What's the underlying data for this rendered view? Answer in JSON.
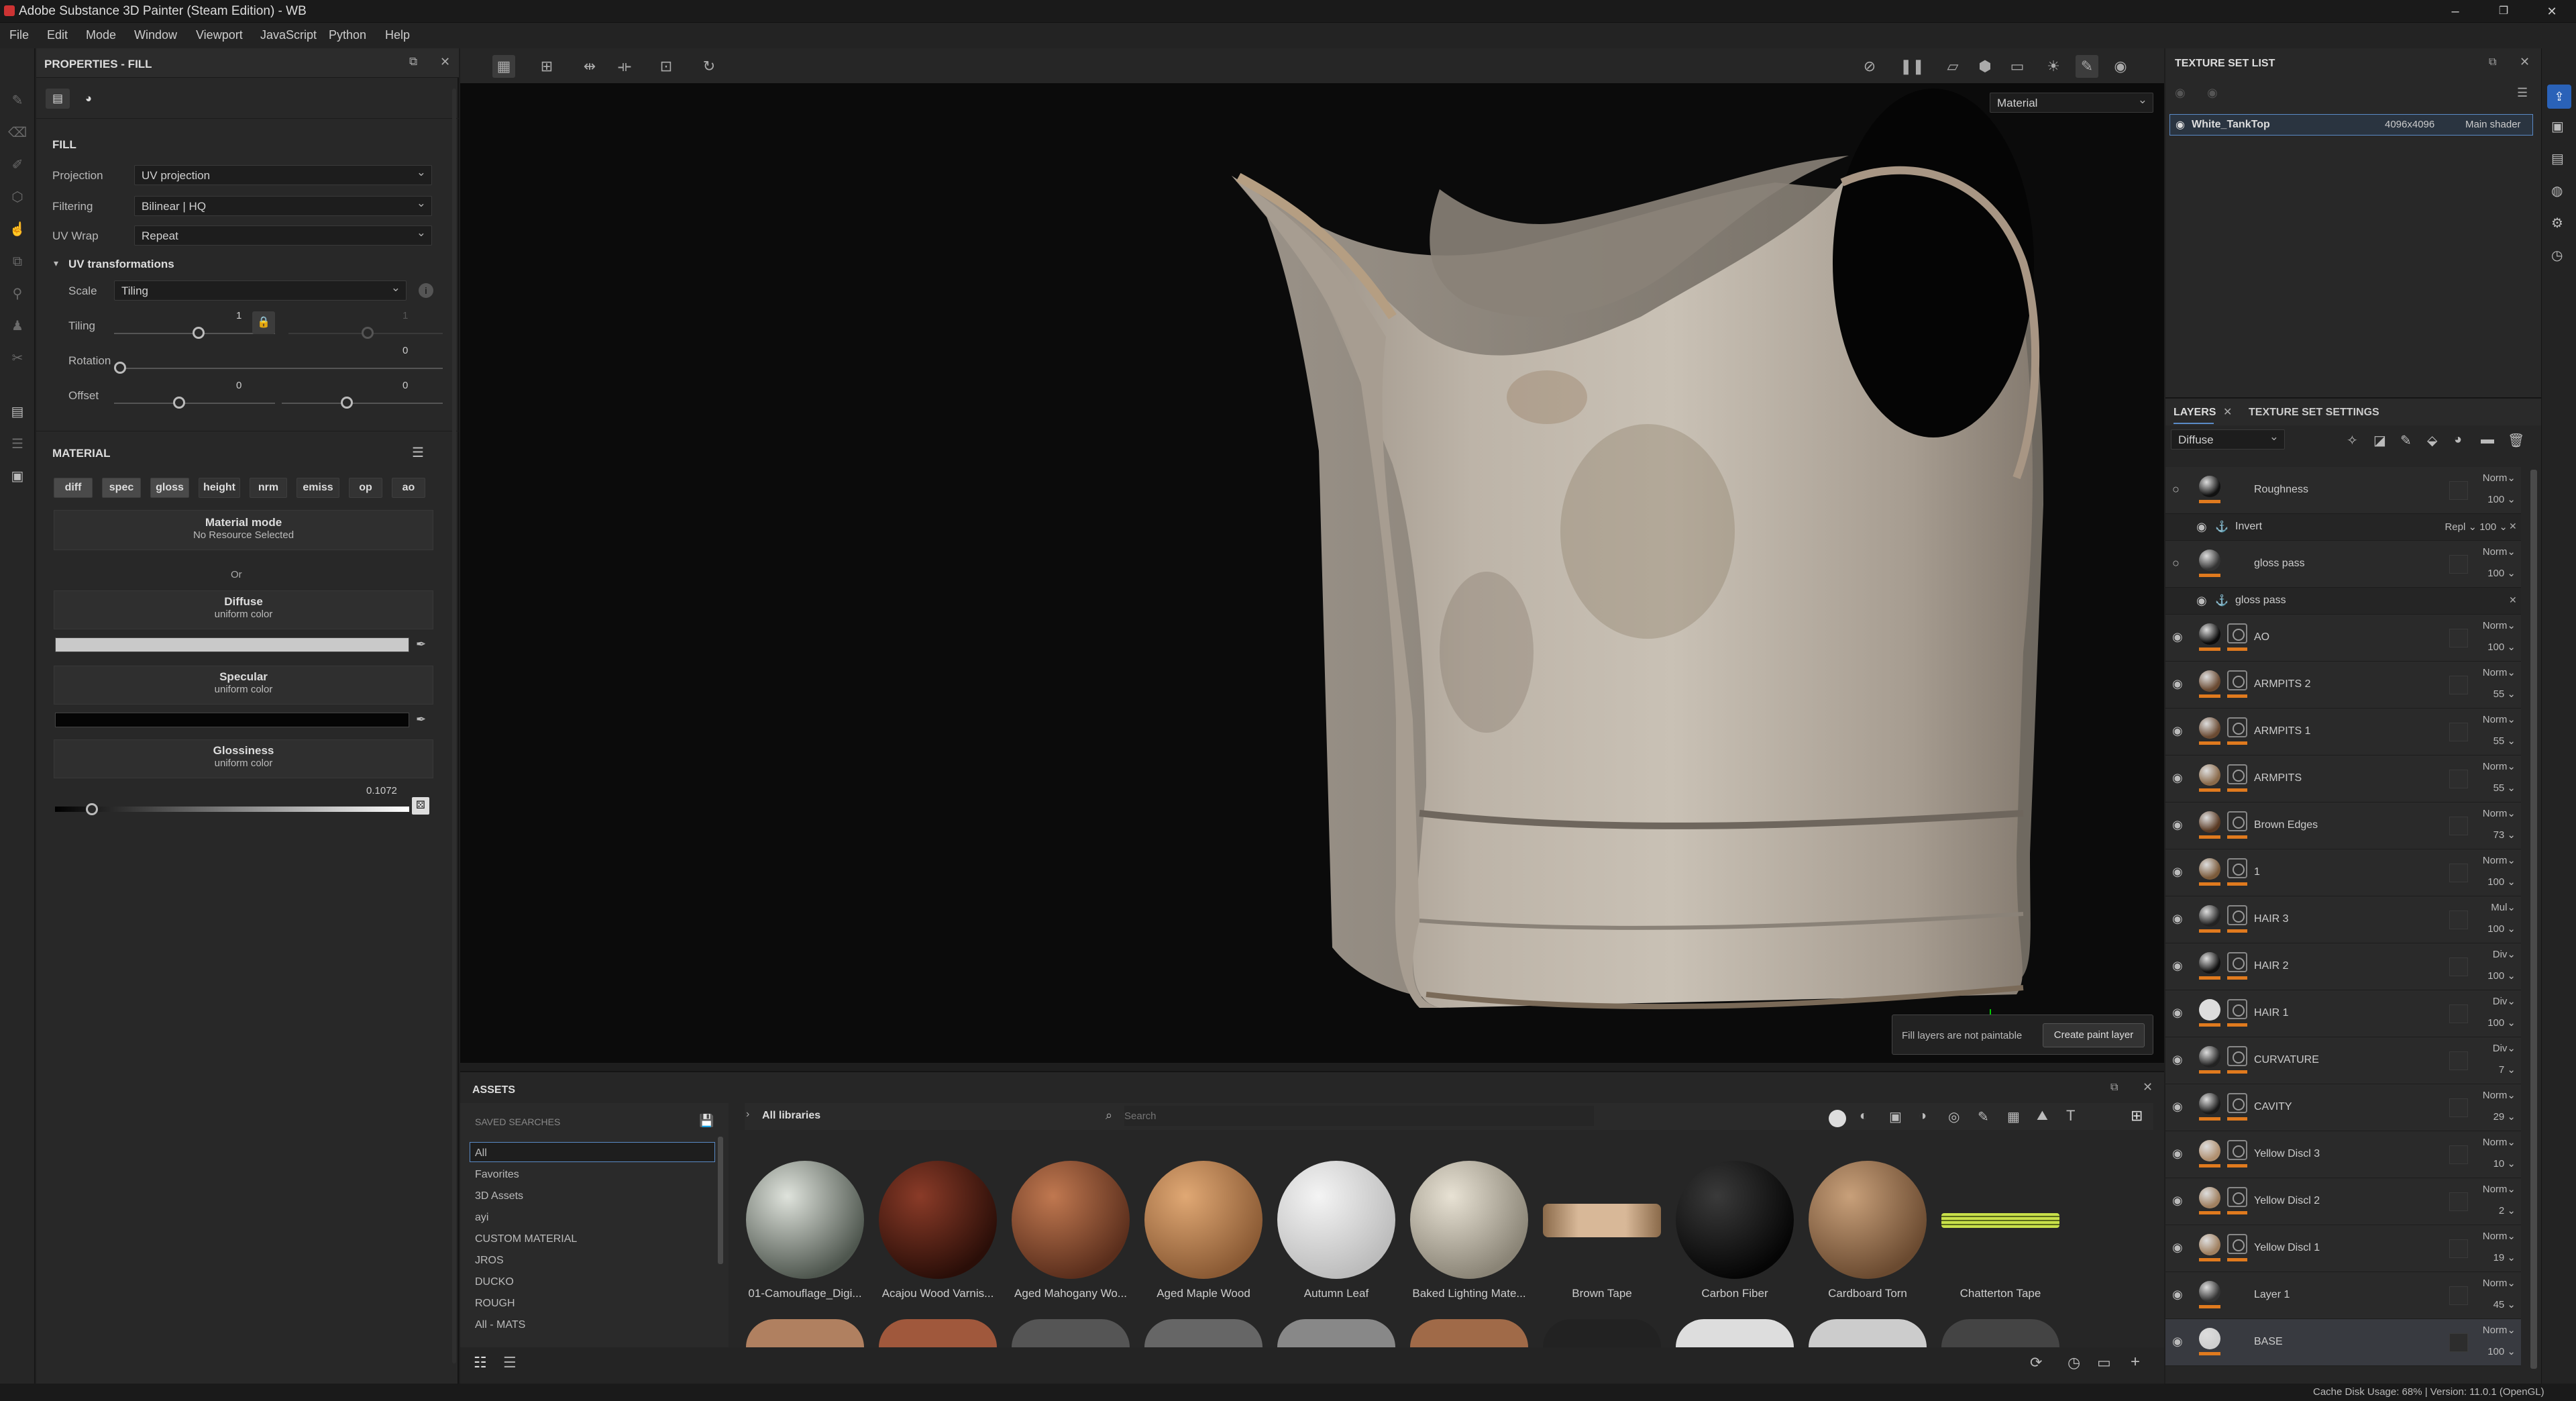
{
  "window": {
    "title": "Adobe Substance 3D Painter (Steam Edition) - WB",
    "min": "–",
    "max": "❐",
    "close": "✕"
  },
  "menu": [
    "File",
    "Edit",
    "Mode",
    "Window",
    "Viewport",
    "JavaScript",
    "Python",
    "Help"
  ],
  "props": {
    "header": "PROPERTIES - FILL",
    "fill_title": "FILL",
    "projection_label": "Projection",
    "projection_value": "UV projection",
    "filtering_label": "Filtering",
    "filtering_value": "Bilinear | HQ",
    "uvwrap_label": "UV Wrap",
    "uvwrap_value": "Repeat",
    "uvtrans_label": "UV transformations",
    "scale_label": "Scale",
    "scale_value": "Tiling",
    "tiling_label": "Tiling",
    "tiling_value": "1",
    "tiling_value2": "1",
    "rotation_label": "Rotation",
    "rotation_value": "0",
    "offset_label": "Offset",
    "offset_value_u": "0",
    "offset_value_v": "0",
    "material_title": "MATERIAL",
    "channels": [
      "diff",
      "spec",
      "gloss",
      "height",
      "nrm",
      "emiss",
      "op",
      "ao"
    ],
    "material_mode": "Material mode",
    "no_resource": "No Resource Selected",
    "or": "Or",
    "diffuse": "Diffuse",
    "specular": "Specular",
    "glossiness": "Glossiness",
    "uniform": "uniform color",
    "gloss_value": "0.1072",
    "diffuse_color": "#c9c9c9",
    "specular_color": "#050505"
  },
  "viewport": {
    "mode": "Material",
    "tooltip": "Fill layers are not paintable",
    "create_button": "Create paint layer"
  },
  "texture_set": {
    "header": "TEXTURE SET LIST",
    "name": "White_TankTop",
    "res": "4096x4096",
    "shader": "Main shader"
  },
  "layers_panel": {
    "tab1": "LAYERS",
    "tab2": "TEXTURE SET SETTINGS",
    "channel": "Diffuse",
    "rows": [
      {
        "name": "Roughness",
        "blend": "Norm",
        "op": "100",
        "thumb": "#111"
      },
      {
        "name": "Invert",
        "blend": "Repl",
        "op": "100",
        "sub": true
      },
      {
        "name": "gloss pass",
        "blend": "Norm",
        "op": "100",
        "thumb": "#333"
      },
      {
        "name": "gloss pass",
        "blend": "",
        "op": "",
        "sub": true
      },
      {
        "name": "AO",
        "blend": "Norm",
        "op": "100",
        "thumb": "#0c0c0c"
      },
      {
        "name": "ARMPITS 2",
        "blend": "Norm",
        "op": "55",
        "thumb": "#6a4a32"
      },
      {
        "name": "ARMPITS 1",
        "blend": "Norm",
        "op": "55",
        "thumb": "#6a4a32"
      },
      {
        "name": "ARMPITS",
        "blend": "Norm",
        "op": "55",
        "thumb": "#8a6a4a"
      },
      {
        "name": "Brown Edges",
        "blend": "Norm",
        "op": "73",
        "thumb": "#5a3a24"
      },
      {
        "name": "1",
        "blend": "Norm",
        "op": "100",
        "thumb": "#7a5a3a"
      },
      {
        "name": "HAIR 3",
        "blend": "Mul",
        "op": "100",
        "thumb": "#222"
      },
      {
        "name": "HAIR 2",
        "blend": "Div",
        "op": "100",
        "thumb": "#111"
      },
      {
        "name": "HAIR 1",
        "blend": "Div",
        "op": "100",
        "thumb": "#ddd"
      },
      {
        "name": "CURVATURE",
        "blend": "Div",
        "op": "7",
        "thumb": "#222"
      },
      {
        "name": "CAVITY",
        "blend": "Norm",
        "op": "29",
        "thumb": "#1a1a1a"
      },
      {
        "name": "Yellow Discl 3",
        "blend": "Norm",
        "op": "10",
        "thumb": "#b09070"
      },
      {
        "name": "Yellow Discl 2",
        "blend": "Norm",
        "op": "2",
        "thumb": "#a08060"
      },
      {
        "name": "Yellow Discl 1",
        "blend": "Norm",
        "op": "19",
        "thumb": "#a08060"
      },
      {
        "name": "Layer 1",
        "blend": "Norm",
        "op": "45",
        "thumb": "#333"
      },
      {
        "name": "BASE",
        "blend": "Norm",
        "op": "100",
        "thumb": "#cfcfcf"
      }
    ]
  },
  "assets": {
    "header": "ASSETS",
    "saved": "SAVED SEARCHES",
    "all_libs": "All libraries",
    "search_placeholder": "Search",
    "libs": [
      "All",
      "Favorites",
      "3D Assets",
      "ayi",
      "CUSTOM MATERIAL",
      "JROS",
      "DUCKO",
      "ROUGH",
      "All - MATS"
    ],
    "materials": [
      {
        "name": "01-Camouflage_Digi...",
        "c1": "#dfe3dc",
        "c2": "#4e564e"
      },
      {
        "name": "Acajou Wood Varnis...",
        "c1": "#8a3b28",
        "c2": "#2a0e08"
      },
      {
        "name": "Aged Mahogany Wo...",
        "c1": "#c07850",
        "c2": "#5a2e1c"
      },
      {
        "name": "Aged Maple Wood",
        "c1": "#e0a874",
        "c2": "#8a5a34"
      },
      {
        "name": "Autumn Leaf",
        "c1": "#f4f4f4",
        "c2": "#bcbcbc"
      },
      {
        "name": "Baked Lighting Mate...",
        "c1": "#e8e2d4",
        "c2": "#8a8476"
      },
      {
        "name": "Brown Tape",
        "c1": "#d8b898",
        "c2": "#8a6a4a"
      },
      {
        "name": "Carbon Fiber",
        "c1": "#3a3a3a",
        "c2": "#050505"
      },
      {
        "name": "Cardboard Torn",
        "c1": "#c8a07a",
        "c2": "#6a4a30"
      },
      {
        "name": "Chatterton Tape",
        "c1": "#c8e04a",
        "c2": "#5a6a1a"
      }
    ]
  },
  "status": {
    "text": "Cache Disk Usage:   68% | Version: 11.0.1 (OpenGL)"
  }
}
